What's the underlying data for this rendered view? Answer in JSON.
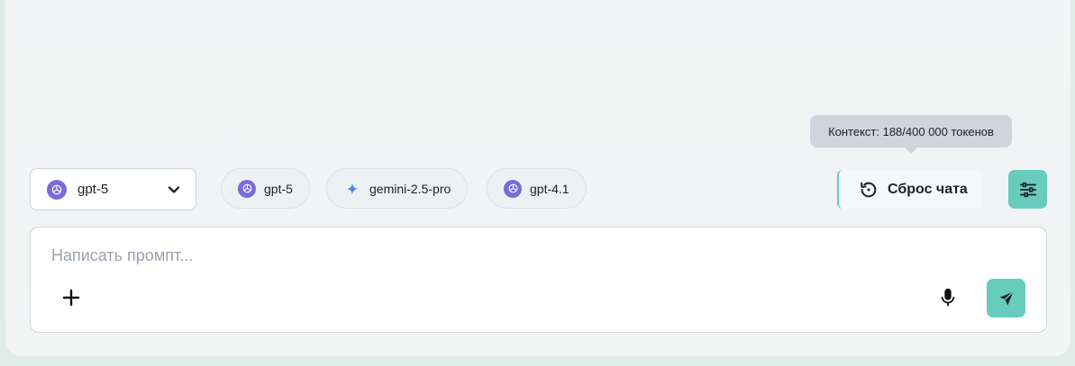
{
  "tooltip": {
    "text": "Контекст: 188/400 000 токенов"
  },
  "model_select": {
    "value": "gpt-5",
    "icon": "openai-icon"
  },
  "quick_models": [
    {
      "label": "gpt-5",
      "icon": "openai-icon"
    },
    {
      "label": "gemini-2.5-pro",
      "icon": "gemini-sparkle-icon"
    },
    {
      "label": "gpt-4.1",
      "icon": "openai-icon"
    }
  ],
  "toolbar": {
    "reset_label": "Сброс чата",
    "settings_icon": "sliders-icon"
  },
  "composer": {
    "placeholder": "Написать промпт...",
    "value": "",
    "attach_icon": "plus-icon",
    "mic_icon": "microphone-icon",
    "send_icon": "send-icon"
  },
  "colors": {
    "accent": "#67ccbe",
    "openai_icon_bg": "#7b6ad8",
    "gemini_icon": "#4a84e8",
    "tooltip_bg": "#cfd5da"
  }
}
